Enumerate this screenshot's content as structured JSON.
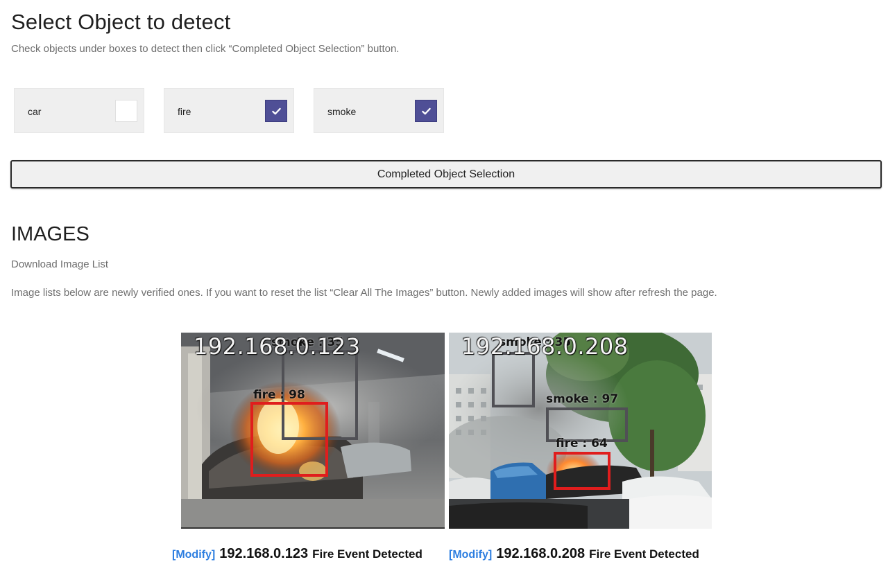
{
  "header": {
    "title": "Select Object to detect",
    "instruction": "Check objects under boxes to detect then click “Completed Object Selection” button."
  },
  "objects": [
    {
      "label": "car",
      "checked": false
    },
    {
      "label": "fire",
      "checked": true
    },
    {
      "label": "smoke",
      "checked": true
    }
  ],
  "complete_button": {
    "label": "Completed Object Selection"
  },
  "images_section": {
    "title": "IMAGES",
    "download_label": "Download Image List",
    "description": "Image lists below are newly verified ones. If you want to reset the list “Clear All The Images” button. Newly added images will show after refresh the page."
  },
  "images": [
    {
      "overlay_ip": "192.168.0.123",
      "detections": [
        {
          "label": "smoke : 35"
        },
        {
          "label": "fire : 98"
        }
      ],
      "modify_label": "[Modify]",
      "ip": "192.168.0.123",
      "event": "Fire Event Detected"
    },
    {
      "overlay_ip": "192.168.0.208",
      "detections": [
        {
          "label": "smoke : 35"
        },
        {
          "label": "smoke : 97"
        },
        {
          "label": "fire : 64"
        }
      ],
      "modify_label": "[Modify]",
      "ip": "192.168.0.208",
      "event": "Fire Event Detected"
    }
  ],
  "colors": {
    "checkbox_checked": "#4f4f96",
    "link": "#2d7ee0",
    "fire_box": "#e01d1d",
    "smoke_box": "#505055"
  }
}
